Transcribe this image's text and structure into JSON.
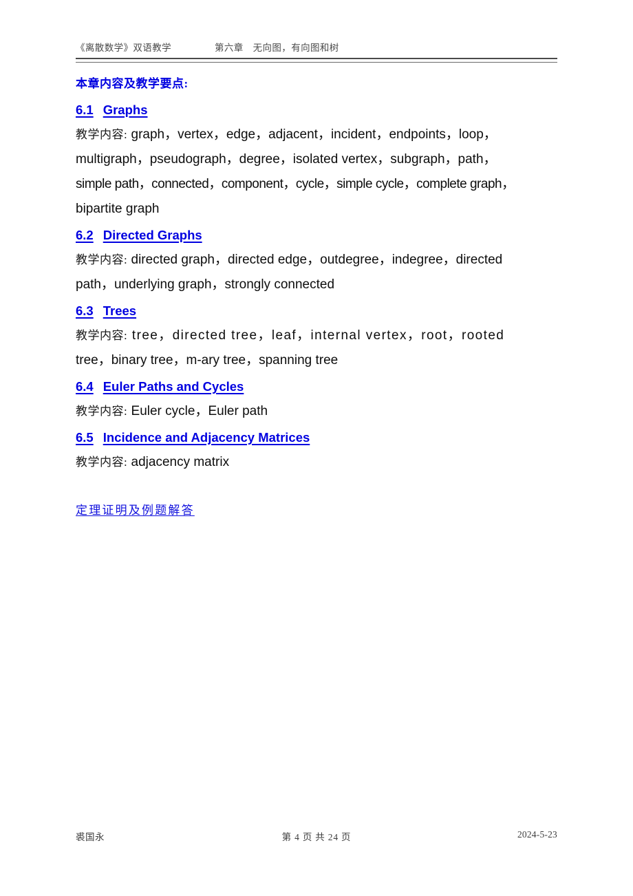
{
  "header": {
    "left": "《离散数学》双语教学",
    "center": "第六章　无向图，有向图和树"
  },
  "content": {
    "intro": "本章内容及教学要点:",
    "teach_label": "教学内容:",
    "sections": [
      {
        "number": "6.1",
        "title": "Graphs",
        "lines": [
          "graph，vertex，edge，adjacent，incident，endpoints，loop，",
          "multigraph，pseudograph，degree，isolated vertex，subgraph，path，",
          "simple path，connected，component，cycle，simple cycle，complete graph，",
          "bipartite graph"
        ]
      },
      {
        "number": "6.2",
        "title": "Directed Graphs",
        "lines": [
          "directed graph，directed edge，outdegree，indegree，directed",
          "path，underlying graph，strongly connected"
        ]
      },
      {
        "number": "6.3",
        "title": "Trees",
        "lines": [
          "tree，directed tree，leaf，internal vertex，root，rooted",
          "tree，binary tree，m-ary tree，spanning tree"
        ]
      },
      {
        "number": "6.4",
        "title": "Euler Paths and Cycles",
        "lines": [
          "Euler cycle，Euler path"
        ]
      },
      {
        "number": "6.5",
        "title": "Incidence and Adjacency Matrices",
        "lines": [
          "adjacency matrix"
        ]
      }
    ],
    "bottom_link": "定理证明及例题解答"
  },
  "footer": {
    "author": "裘国永",
    "pagination": "第 4 页 共 24 页",
    "date": "2024-5-23"
  },
  "colors": {
    "heading_blue": "#0000e0",
    "link_blue": "#1111dd",
    "body_text": "#0d0d0d",
    "rule_gray": "#4a4a4a"
  }
}
